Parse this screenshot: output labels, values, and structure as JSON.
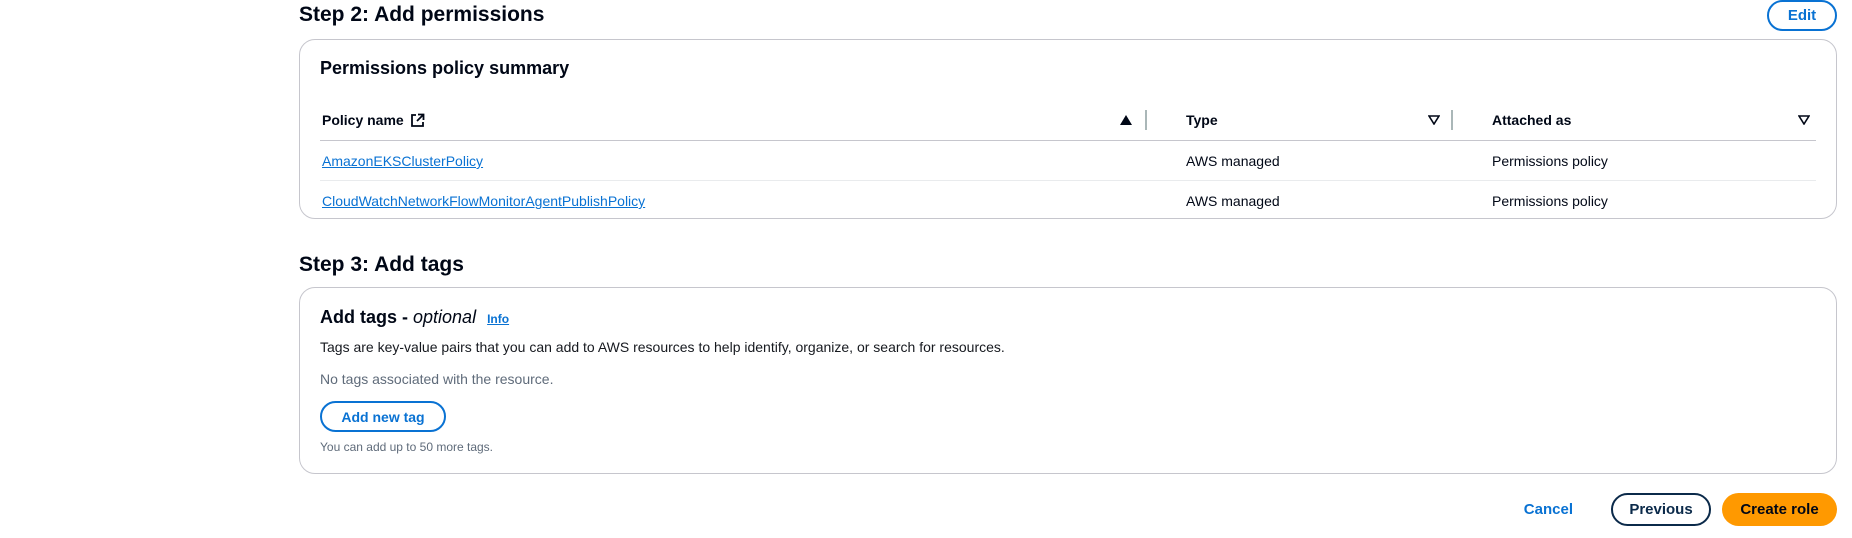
{
  "step2": {
    "title": "Step 2: Add permissions",
    "edit_label": "Edit",
    "panel_title": "Permissions policy summary",
    "columns": {
      "policy_name": "Policy name",
      "type": "Type",
      "attached_as": "Attached as"
    },
    "rows": [
      {
        "policy_name": "AmazonEKSClusterPolicy",
        "type": "AWS managed",
        "attached_as": "Permissions policy"
      },
      {
        "policy_name": "CloudWatchNetworkFlowMonitorAgentPublishPolicy",
        "type": "AWS managed",
        "attached_as": "Permissions policy"
      }
    ]
  },
  "step3": {
    "title": "Step 3: Add tags",
    "panel_title": "Add tags -",
    "panel_title_optional": "optional",
    "info_label": "Info",
    "description": "Tags are key-value pairs that you can add to AWS resources to help identify, organize, or search for resources.",
    "empty_text": "No tags associated with the resource.",
    "add_tag_label": "Add new tag",
    "hint": "You can add up to 50 more tags."
  },
  "footer": {
    "cancel_label": "Cancel",
    "previous_label": "Previous",
    "create_label": "Create role"
  },
  "colors": {
    "link": "#0972d3",
    "primary": "#ff9900",
    "border": "#c6c6cd"
  }
}
